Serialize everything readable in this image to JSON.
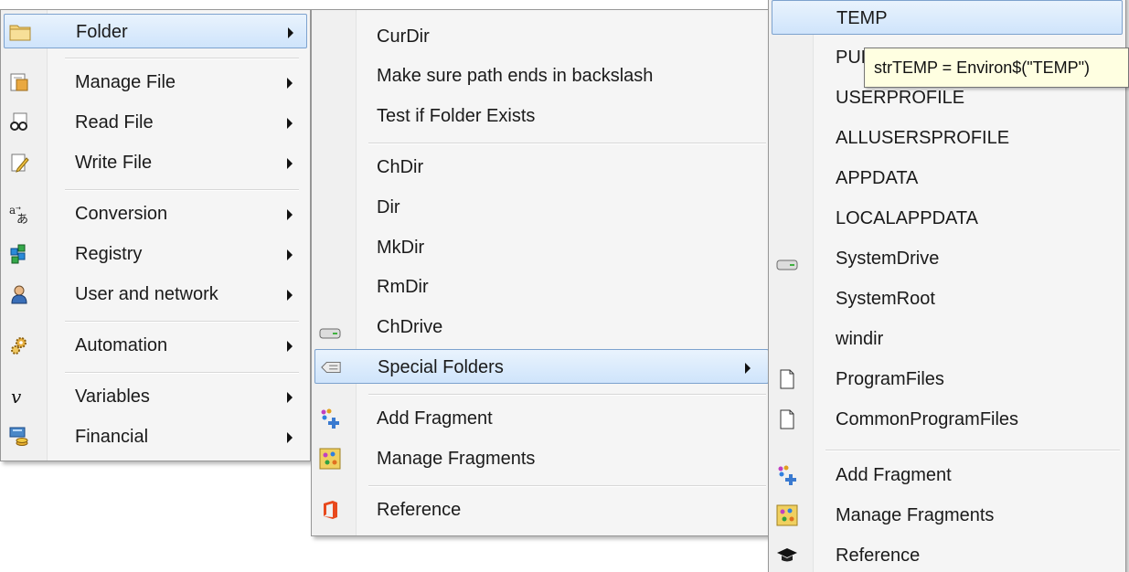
{
  "main_menu": {
    "items": [
      {
        "label": "Folder",
        "icon": "folder-icon",
        "submenu": true,
        "highlighted": true
      },
      {
        "label": "Manage File",
        "icon": "manage-file-icon",
        "submenu": true
      },
      {
        "label": "Read File",
        "icon": "read-file-icon",
        "submenu": true
      },
      {
        "label": "Write File",
        "icon": "write-file-icon",
        "submenu": true
      },
      {
        "label": "Conversion",
        "icon": "conversion-icon",
        "submenu": true
      },
      {
        "label": "Registry",
        "icon": "registry-icon",
        "submenu": true
      },
      {
        "label": "User and network",
        "icon": "user-icon",
        "submenu": true
      },
      {
        "label": "Automation",
        "icon": "gears-icon",
        "submenu": true
      },
      {
        "label": "Variables",
        "icon": "variables-icon",
        "submenu": true
      },
      {
        "label": "Financial",
        "icon": "financial-icon",
        "submenu": true
      }
    ]
  },
  "folder_menu": {
    "items": [
      {
        "label": "CurDir"
      },
      {
        "label": "Make sure path ends in backslash"
      },
      {
        "label": "Test if Folder Exists"
      },
      {
        "label": "ChDir"
      },
      {
        "label": "Dir"
      },
      {
        "label": "MkDir"
      },
      {
        "label": "RmDir"
      },
      {
        "label": "ChDrive",
        "icon": "drive-icon"
      },
      {
        "label": "Special Folders",
        "icon": "special-folders-icon",
        "submenu": true,
        "highlighted": true
      },
      {
        "label": "Add Fragment",
        "icon": "add-fragment-icon"
      },
      {
        "label": "Manage Fragments",
        "icon": "manage-fragments-icon"
      },
      {
        "label": "Reference",
        "icon": "office-icon"
      }
    ]
  },
  "special_menu": {
    "items": [
      {
        "label": "TEMP",
        "highlighted": true
      },
      {
        "label": "PUBLIC"
      },
      {
        "label": "USERPROFILE"
      },
      {
        "label": "ALLUSERSPROFILE"
      },
      {
        "label": "APPDATA"
      },
      {
        "label": "LOCALAPPDATA"
      },
      {
        "label": "SystemDrive",
        "icon": "drive-icon"
      },
      {
        "label": "SystemRoot"
      },
      {
        "label": "windir"
      },
      {
        "label": "ProgramFiles",
        "icon": "document-icon"
      },
      {
        "label": "CommonProgramFiles",
        "icon": "document-icon"
      },
      {
        "label": "Add Fragment",
        "icon": "add-fragment-icon"
      },
      {
        "label": "Manage Fragments",
        "icon": "manage-fragments-icon"
      },
      {
        "label": "Reference",
        "icon": "mortarboard-icon"
      }
    ]
  },
  "tooltip": {
    "text": "strTEMP = Environ$(\"TEMP\")"
  },
  "colors": {
    "highlight_top": "#e9f3fd",
    "highlight_bottom": "#cfe4fb",
    "highlight_border": "#7da2ce",
    "menu_background": "#f5f5f5",
    "tooltip_background": "#ffffe1"
  }
}
